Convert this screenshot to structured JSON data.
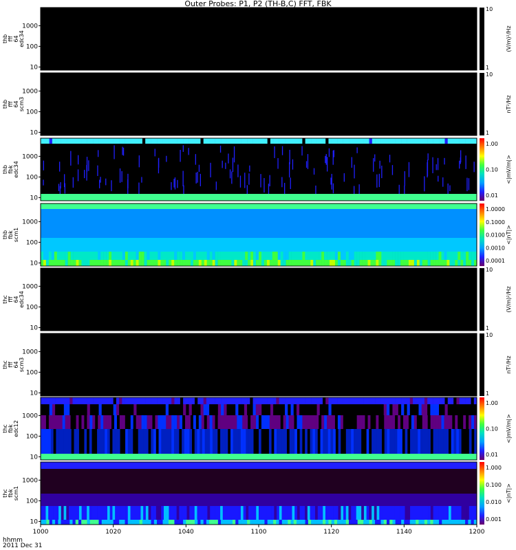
{
  "title": "Outer Probes: P1, P2 (TH-B,C) FFT, FBK",
  "x_axis_header": [
    "hhmm",
    "2011 Dec 31"
  ],
  "chart_data": {
    "type": "heatmap",
    "title": "Outer Probes: P1, P2 (TH-B,C) FFT, FBK",
    "x_ticks": [
      "1000",
      "1020",
      "1040",
      "1100",
      "1120",
      "1140",
      "1200"
    ],
    "panels": [
      {
        "ylabel": [
          "thb",
          "fff",
          "64",
          "edc34"
        ],
        "yticks": [
          "1000",
          "100",
          "10"
        ],
        "cbar_ticks": [
          "10",
          "1"
        ],
        "cbar_label": "(V/m)²/Hz",
        "empty": true
      },
      {
        "ylabel": [
          "thb",
          "fff",
          "64",
          "scm3"
        ],
        "yticks": [
          "1000",
          "100",
          "10"
        ],
        "cbar_ticks": [
          "10",
          "1"
        ],
        "cbar_label": "nT²/Hz",
        "empty": true
      },
      {
        "ylabel": [
          "thb",
          "fbk",
          "edc34"
        ],
        "yticks": [
          "1000",
          "100",
          "10"
        ],
        "cbar_ticks": [
          "1.00",
          "0.10",
          "0.01"
        ],
        "cbar_label": "<|mV/m|>",
        "empty": false
      },
      {
        "ylabel": [
          "thb",
          "fbk",
          "scm1"
        ],
        "yticks": [
          "1000",
          "100",
          "10"
        ],
        "cbar_ticks": [
          "1.0000",
          "0.1000",
          "0.0100",
          "0.0010",
          "0.0001"
        ],
        "cbar_label": "<|nT|>",
        "empty": false
      },
      {
        "ylabel": [
          "thc",
          "fff",
          "64",
          "edc34"
        ],
        "yticks": [
          "1000",
          "100",
          "10"
        ],
        "cbar_ticks": [
          "10",
          "1"
        ],
        "cbar_label": "(V/m)²/Hz",
        "empty": true
      },
      {
        "ylabel": [
          "thc",
          "fff",
          "64",
          "scm3"
        ],
        "yticks": [
          "1000",
          "100",
          "10"
        ],
        "cbar_ticks": [
          "10",
          "1"
        ],
        "cbar_label": "nT²/Hz",
        "empty": true
      },
      {
        "ylabel": [
          "thc",
          "fbk",
          "edc12"
        ],
        "yticks": [
          "1000",
          "100",
          "10"
        ],
        "cbar_ticks": [
          "1.00",
          "0.10",
          "0.01"
        ],
        "cbar_label": "<|mV/m|>",
        "empty": false
      },
      {
        "ylabel": [
          "thc",
          "fbk",
          "scm1"
        ],
        "yticks": [
          "1000",
          "100",
          "10"
        ],
        "cbar_ticks": [
          "1.000",
          "0.100",
          "0.010",
          "0.001"
        ],
        "cbar_label": "<|nT|>",
        "empty": false
      }
    ]
  },
  "colors": {
    "background": "#000000",
    "colorbar": [
      "#6a006a",
      "#2020ff",
      "#00a0ff",
      "#00e0c0",
      "#40ff40",
      "#ffff00",
      "#ff8000",
      "#ff0000"
    ],
    "edc34_thb": [
      "#40f0ff",
      "#000000",
      "#2020ff",
      "#40ff90"
    ],
    "scm1_thb": [
      "#40ff90",
      "#0090ff",
      "#00c8ff",
      "#00e8c8",
      "#40ff40",
      "#c0ff00"
    ],
    "edc12_thc": [
      "#2020ff",
      "#000000",
      "#600080",
      "#0030ff",
      "#0020c0",
      "#40ff90"
    ],
    "scm1_thc": [
      "#2020ff",
      "#200020",
      "#3000a0",
      "#1818ff",
      "#00c0ff"
    ]
  }
}
